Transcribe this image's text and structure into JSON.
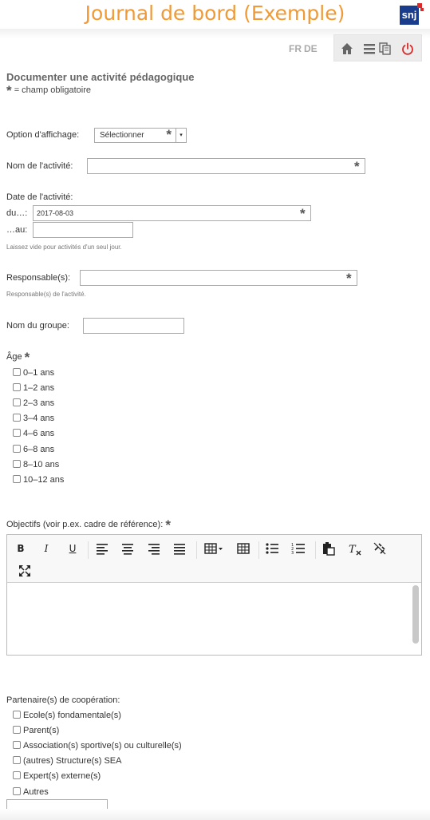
{
  "header": {
    "title": "Journal de bord (Exemple)",
    "logo_text": "snj"
  },
  "languages": [
    "FR",
    "DE"
  ],
  "toolbar": {
    "icons": [
      "home-icon",
      "list-icon",
      "copy-icon",
      "power-icon"
    ],
    "power_color": "#d92b2b"
  },
  "form": {
    "title": "Documenter une activité pédagogique",
    "required_legend": "= champ obligatoire",
    "required_marker": "*",
    "display_option": {
      "label": "Option d'affichage:",
      "value": "Sélectionner"
    },
    "activity_name": {
      "label": "Nom de l'activité:",
      "value": ""
    },
    "activity_date": {
      "label": "Date de l'activité:",
      "from_label": "du…:",
      "from_value": "2017-08-03",
      "to_label": "…au:",
      "to_value": "",
      "hint": "Laissez vide pour activités d'un seul jour."
    },
    "responsible": {
      "label": "Responsable(s):",
      "value": "",
      "hint": "Responsable(s) de l'activité."
    },
    "group_name": {
      "label": "Nom du groupe:",
      "value": ""
    },
    "age": {
      "label": "Âge",
      "options": [
        "0–1 ans",
        "1–2 ans",
        "2–3 ans",
        "3–4 ans",
        "4–6 ans",
        "6–8 ans",
        "8–10 ans",
        "10–12 ans"
      ]
    },
    "objectives": {
      "label": "Objectifs (voir p.ex. cadre de référence):",
      "toolbar": [
        "bold",
        "italic",
        "underline",
        "align-left",
        "align-center",
        "align-right",
        "align-justify",
        "table-menu",
        "table",
        "bullet-list",
        "numbered-list",
        "paste",
        "clear-format",
        "unlink",
        "fullscreen"
      ],
      "value": ""
    },
    "partners": {
      "label": "Partenaire(s) de coopération:",
      "options": [
        "Ecole(s) fondamentale(s)",
        "Parent(s)",
        "Association(s) sportive(s) ou culturelle(s)",
        "(autres) Structure(s) SEA",
        "Expert(s) externe(s)",
        "Autres"
      ],
      "other_value": ""
    }
  },
  "colors": {
    "title_orange": "#ef9a36",
    "logo_blue": "#1a3c8c"
  }
}
